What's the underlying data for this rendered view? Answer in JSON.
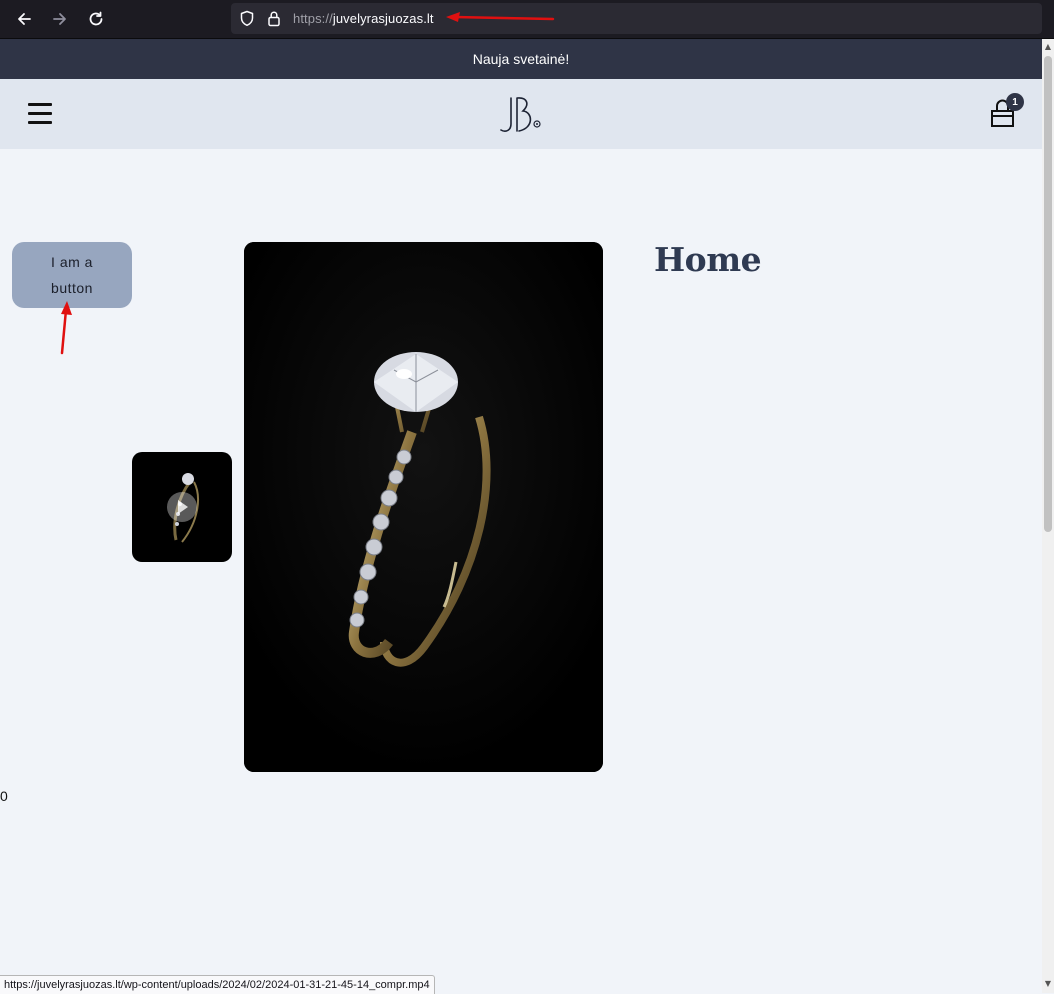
{
  "browser": {
    "url_scheme": "https://",
    "url_host": "juvelyrasjuozas.lt",
    "status_url": "https://juvelyrasjuozas.lt/wp-content/uploads/2024/02/2024-01-31-21-45-14_compr.mp4",
    "icons": [
      "back-arrow-icon",
      "forward-arrow-icon",
      "reload-icon",
      "shield-icon",
      "lock-icon"
    ]
  },
  "site": {
    "announcement": "Nauja svetainė!",
    "cart_count": "1",
    "button_label": "I am a button",
    "page_title": "Home",
    "counter_text": "0"
  },
  "colors": {
    "announce_bg": "#2f3446",
    "header_bg": "#e0e6ef",
    "button_bg": "#97a6bf",
    "annotation_red": "#e01010"
  }
}
